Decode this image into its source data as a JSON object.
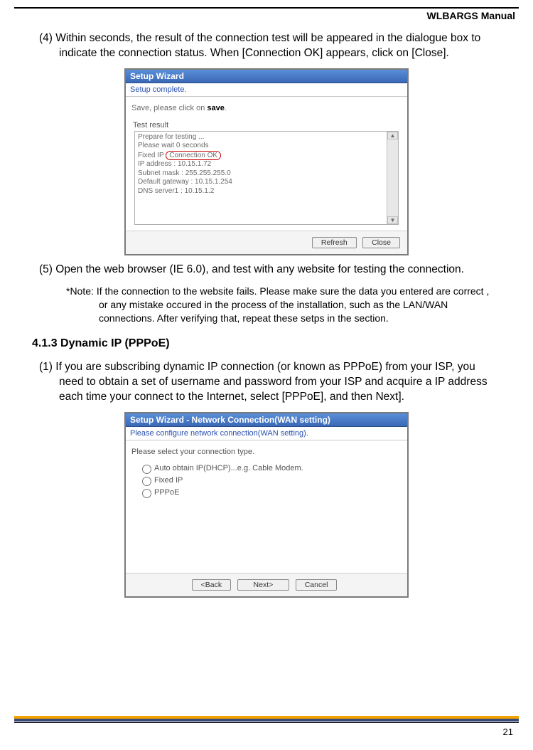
{
  "header": {
    "manual_title": "WLBARGS Manual"
  },
  "steps": {
    "s4": {
      "num": "(4)",
      "text": "Within seconds, the result of the connection test will be appeared in the dialogue box to indicate the connection status. When [Connection OK] appears, click on [Close]."
    },
    "s5": {
      "num": "(5)",
      "text": "Open the web browser (IE 6.0), and test with any website for testing the connection."
    },
    "s1b": {
      "num": "(1)",
      "text": "If you are subscribing dynamic IP connection (or known as PPPoE) from your ISP, you need to obtain a set of username and password from your ISP and acquire a IP address each time your connect to the Internet, select [PPPoE], and then Next]."
    }
  },
  "note": {
    "label": "*Note:",
    "text": "If the connection to the website fails. Please make sure the data you entered are correct , or any mistake occured in the process of the installation, such as the LAN/WAN connections. After verifying that, repeat these setps in the section."
  },
  "section": {
    "heading": "4.1.3 Dynamic IP (PPPoE)"
  },
  "shot1": {
    "title": "Setup Wizard",
    "subtitle": "Setup complete.",
    "save_prefix": "Save, please click on ",
    "save_bold": "save",
    "save_suffix": ".",
    "test_label": "Test result",
    "log": {
      "l1": "Prepare for testing ...",
      "l2": "Please wait 0 seconds",
      "l3a": "Fixed IP ",
      "l3b": "Connection OK",
      "l4": "IP address : 10.15.1.72",
      "l5": "Subnet mask : 255.255.255.0",
      "l6": "Default gateway : 10.15.1.254",
      "l7": "DNS server1 : 10.15.1.2"
    },
    "btn_refresh": "Refresh",
    "btn_close": "Close"
  },
  "shot2": {
    "title": "Setup Wizard - Network Connection(WAN setting)",
    "subtitle": "Please configure network connection(WAN setting).",
    "instruction": "Please select your connection type.",
    "opt1": "Auto obtain IP(DHCP)...e.g. Cable Modem.",
    "opt2": "Fixed IP",
    "opt3": "PPPoE",
    "btn_back": "<Back",
    "btn_next": "Next>",
    "btn_cancel": "Cancel"
  },
  "page": {
    "number": "21"
  }
}
